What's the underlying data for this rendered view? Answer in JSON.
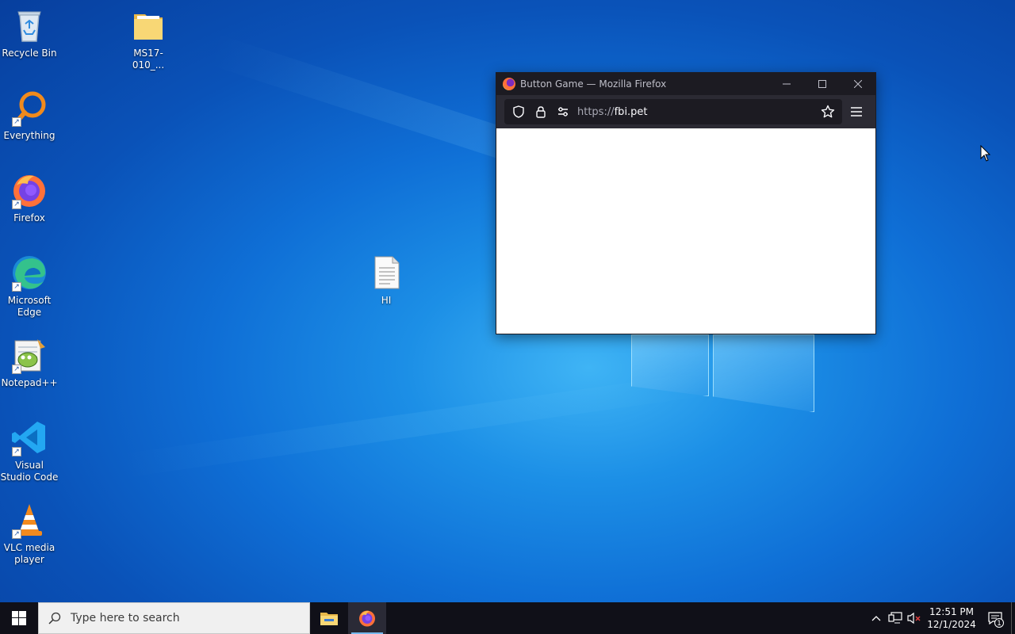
{
  "desktop": {
    "icons": [
      {
        "label": "Recycle Bin"
      },
      {
        "label": "MS17-010_..."
      },
      {
        "label": "Everything"
      },
      {
        "label": "Firefox"
      },
      {
        "label": "Microsoft Edge"
      },
      {
        "label": "Notepad++"
      },
      {
        "label": "Visual Studio Code"
      },
      {
        "label": "VLC media player"
      },
      {
        "label": "HI"
      }
    ]
  },
  "firefox": {
    "title": "Button Game — Mozilla Firefox",
    "url_scheme": "https://",
    "url_host": "fbi.pet",
    "content": ""
  },
  "taskbar": {
    "search_placeholder": "Type here to search",
    "apps": [
      {
        "icon": "file-explorer-icon",
        "active": false
      },
      {
        "icon": "firefox-icon",
        "active": true
      }
    ],
    "clock": {
      "time": "12:51 PM",
      "date": "12/1/2024"
    },
    "notification_count": "1"
  },
  "colors": {
    "taskbar": "#101018",
    "firefox_toolbar": "#2b2a33",
    "firefox_titlebar": "#1c1b22"
  }
}
